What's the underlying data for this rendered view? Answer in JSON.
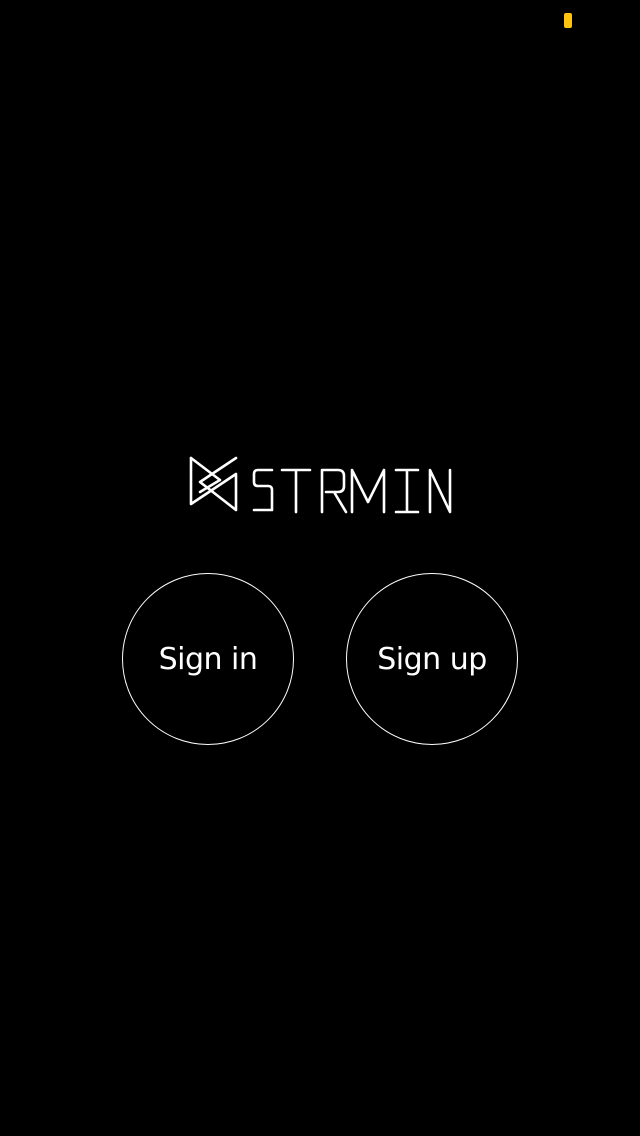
{
  "status_bar": {
    "battery_color": "#FFC20E"
  },
  "branding": {
    "logo_text": "STRMIN",
    "logo_icon": "strmin-bowtie-logo-icon"
  },
  "actions": {
    "sign_in_label": "Sign in",
    "sign_up_label": "Sign up"
  },
  "colors": {
    "background": "#000000",
    "foreground": "#FFFFFF",
    "accent": "#FFC20E"
  }
}
